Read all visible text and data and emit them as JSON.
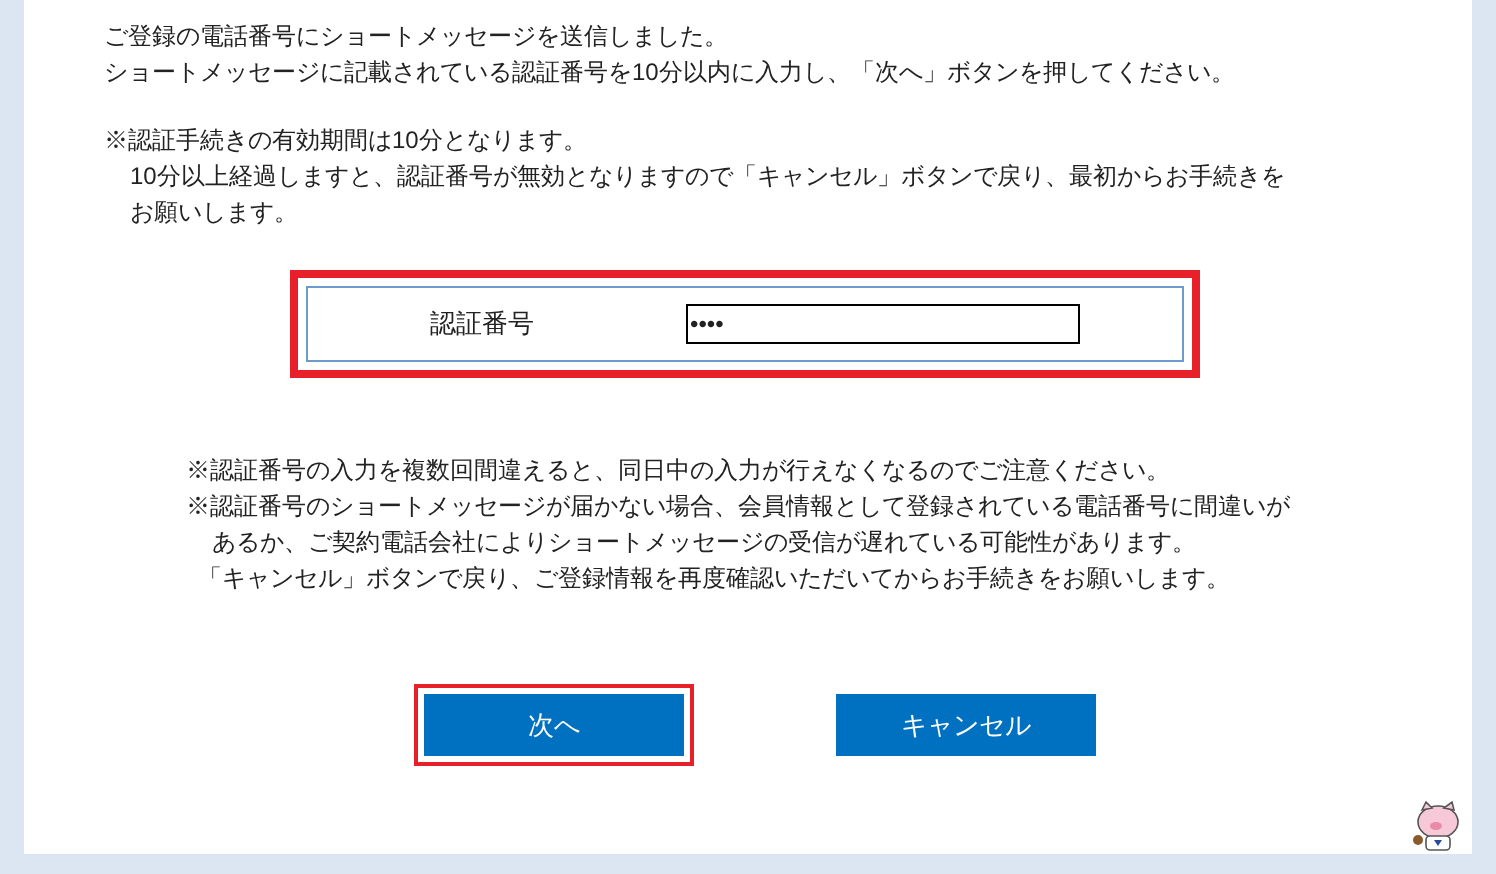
{
  "intro": [
    "ご登録の電話番号にショートメッセージを送信しました。",
    "ショートメッセージに記載されている認証番号を10分以内に入力し、「次へ」ボタンを押してください。"
  ],
  "validity_note": [
    "※認証手続きの有効期間は10分となります。",
    "10分以上経過しますと、認証番号が無効となりますので「キャンセル」ボタンで戻り、最初からお手続きを",
    "お願いします。"
  ],
  "code_form": {
    "highlighted": true,
    "label": "認証番号",
    "value": "••••"
  },
  "notes": [
    "※認証番号の入力を複数回間違えると、同日中の入力が行えなくなるのでご注意ください。",
    "※認証番号のショートメッセージが届かない場合、会員情報として登録されている電話番号に間違いが",
    "あるか、ご契約電話会社によりショートメッセージの受信が遅れている可能性があります。",
    "「キャンセル」ボタンで戻り、ご登録情報を再度確認いただいてからお手続きをお願いします。"
  ],
  "buttons": [
    {
      "label": "次へ",
      "highlighted": true
    },
    {
      "label": "キャンセル",
      "highlighted": false
    }
  ]
}
